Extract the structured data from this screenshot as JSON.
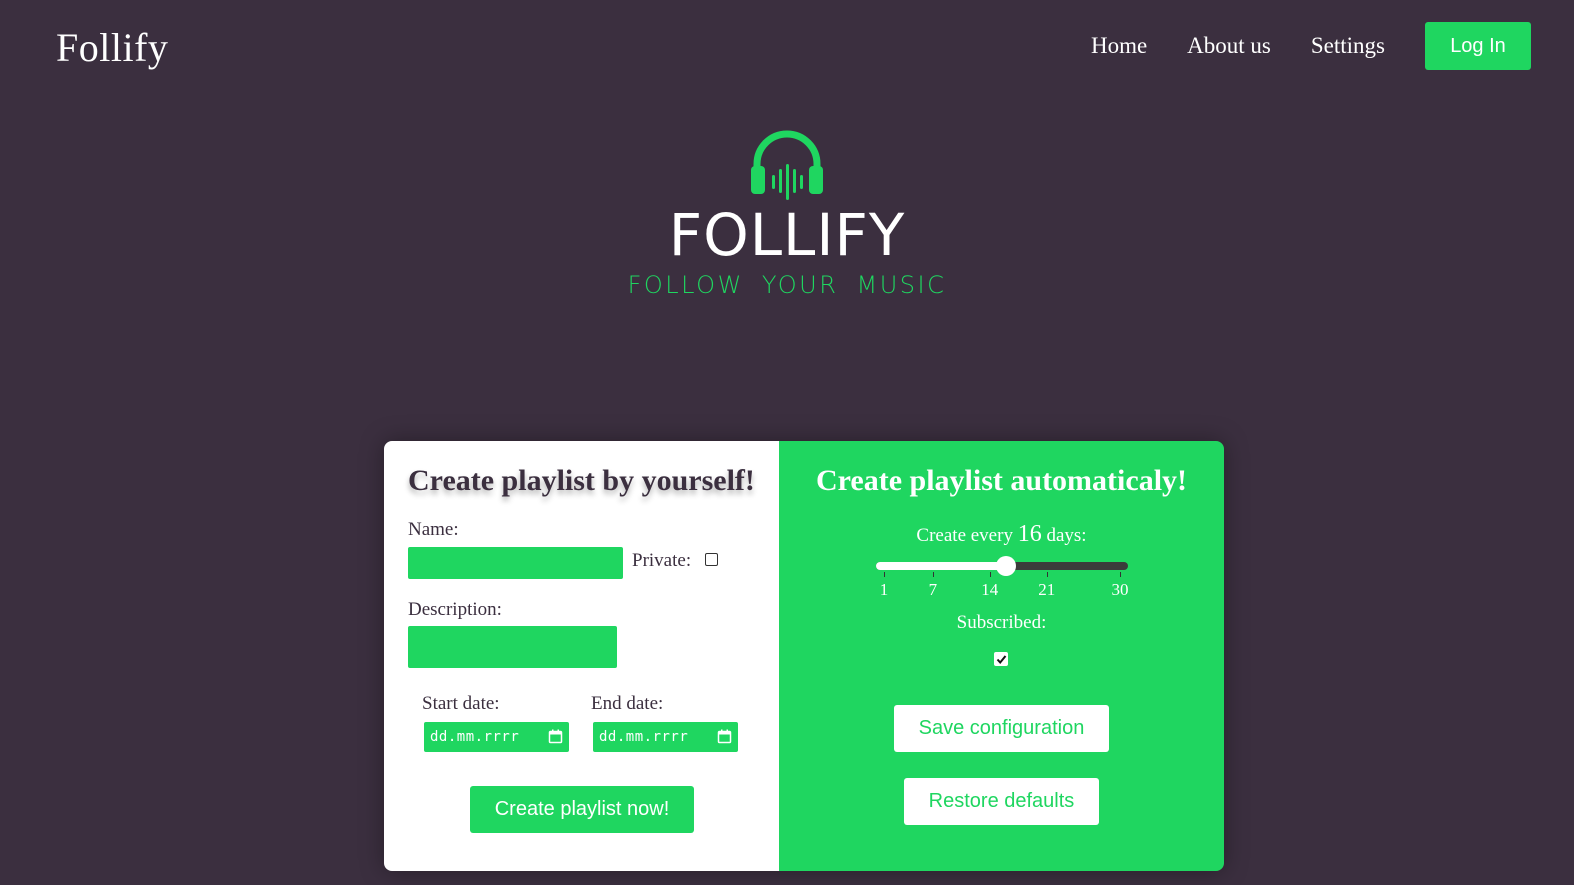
{
  "navbar": {
    "brand": "Follify",
    "links": [
      "Home",
      "About us",
      "Settings"
    ],
    "login_label": "Log In"
  },
  "hero": {
    "icon": "headphones-icon",
    "title": "FOLLIFY",
    "subtitle": "FOLLOW YOUR MUSIC"
  },
  "manual": {
    "heading": "Create playlist by yourself!",
    "name_label": "Name:",
    "name_value": "",
    "private_label": "Private:",
    "private_checked": false,
    "description_label": "Description:",
    "description_value": "",
    "start_label": "Start date:",
    "start_placeholder": "dd.mm.rrrr",
    "end_label": "End date:",
    "end_placeholder": "dd.mm.rrrr",
    "create_label": "Create playlist now!"
  },
  "auto": {
    "heading": "Create playlist automaticaly!",
    "freq_prefix": "Create every",
    "freq_value": "16",
    "freq_suffix": "days:",
    "slider": {
      "min": 1,
      "max": 30,
      "value": 16,
      "ticks": [
        "1",
        "7",
        "14",
        "21",
        "30"
      ]
    },
    "subscribed_label": "Subscribed:",
    "subscribed_checked": true,
    "save_label": "Save configuration",
    "restore_label": "Restore defaults"
  },
  "colors": {
    "background": "#3b2f3f",
    "accent": "#1fd660"
  }
}
